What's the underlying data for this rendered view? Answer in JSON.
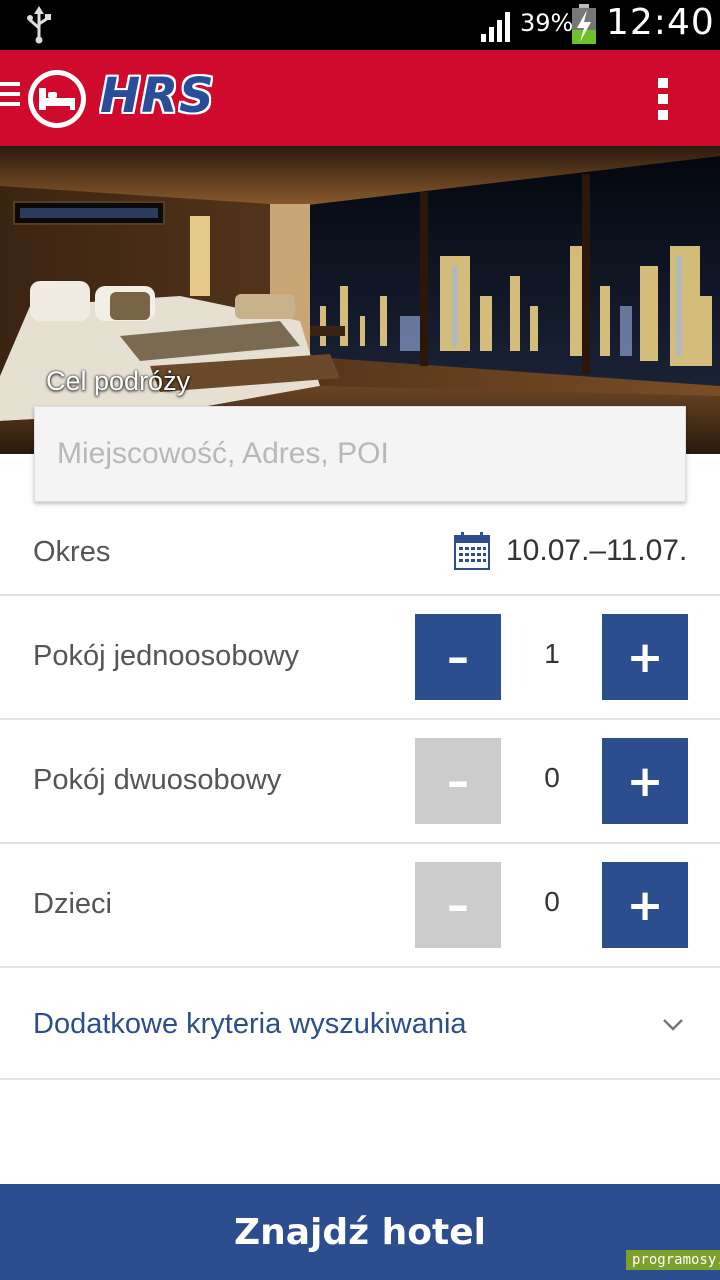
{
  "status_bar": {
    "battery": "39%",
    "time": "12:40"
  },
  "app_bar": {
    "logo_text": "HRS"
  },
  "hero": {
    "destination_label": "Cel podróży"
  },
  "search": {
    "placeholder": "Miejscowość, Adres, POI",
    "value": ""
  },
  "period": {
    "label": "Okres",
    "value": "10.07.–11.07."
  },
  "rooms": [
    {
      "label": "Pokój jednoosobowy",
      "count": "1",
      "minus": "–",
      "plus": "+",
      "minus_enabled": true
    },
    {
      "label": "Pokój dwuosobowy",
      "count": "0",
      "minus": "–",
      "plus": "+",
      "minus_enabled": false
    },
    {
      "label": "Dzieci",
      "count": "0",
      "minus": "–",
      "plus": "+",
      "minus_enabled": false
    }
  ],
  "extra_criteria": {
    "label": "Dodatkowe kryteria wyszukiwania"
  },
  "cta": {
    "label": "Znajdź hotel"
  },
  "watermark": "programosy.pl",
  "colors": {
    "brand_red": "#cf0a2c",
    "brand_blue": "#2c4d8e",
    "disabled": "#cccccc"
  }
}
